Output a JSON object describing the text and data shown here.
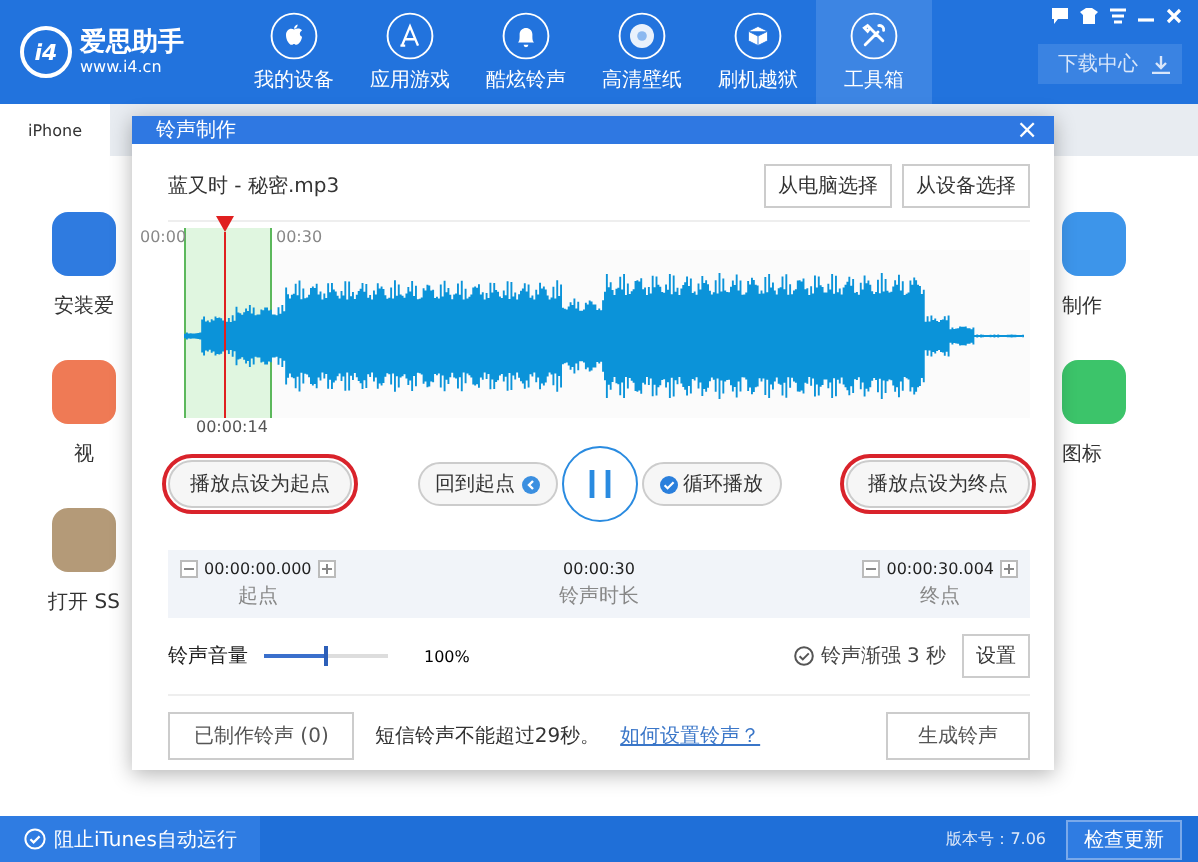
{
  "header": {
    "logo": {
      "mark": "i4",
      "name": "爱思助手",
      "url": "www.i4.cn"
    },
    "nav": [
      {
        "label": "我的设备",
        "selected": false
      },
      {
        "label": "应用游戏",
        "selected": false
      },
      {
        "label": "酷炫铃声",
        "selected": false
      },
      {
        "label": "高清壁纸",
        "selected": false
      },
      {
        "label": "刷机越狱",
        "selected": false
      },
      {
        "label": "工具箱",
        "selected": true
      }
    ],
    "download_button": "下载中心"
  },
  "tabs": [
    {
      "label": "iPhone",
      "selected": true
    }
  ],
  "background_apps_left": [
    {
      "label": "安装爱",
      "color": "#2f7be0"
    },
    {
      "label": "视",
      "color": "#ef7a55"
    },
    {
      "label": "打开 SS",
      "color": "#b49a78"
    }
  ],
  "background_apps_right": [
    {
      "label": "制作",
      "color": "#3d95ea"
    },
    {
      "label": "图标",
      "color": "#3cc46a"
    }
  ],
  "dialog": {
    "title": "铃声制作",
    "close": "×",
    "file_name": "蓝又时 - 秘密.mp3",
    "source_buttons": [
      "从电脑选择",
      "从设备选择"
    ],
    "timeline": {
      "ticks": [
        "00:00",
        "00:30"
      ],
      "playhead_time": "00:00:14"
    },
    "set_start_button": {
      "label": "播放点设为起点",
      "highlighted": true
    },
    "back_to_start": "回到起点",
    "playing": true,
    "loop": {
      "label": "循环播放",
      "checked": true
    },
    "set_end_button": {
      "label": "播放点设为终点",
      "highlighted": true
    },
    "start": {
      "value": "00:00:00.000",
      "label": "起点"
    },
    "duration": {
      "value": "00:00:30",
      "label": "铃声时长"
    },
    "end": {
      "value": "00:00:30.004",
      "label": "终点"
    },
    "volume": {
      "label": "铃声音量",
      "level": 0.5,
      "reading": "100%"
    },
    "fade_in": {
      "label": "铃声渐强 3 秒",
      "checked": true
    },
    "settings_button": "设置",
    "made_button": "已制作铃声 (0)",
    "hint": "短信铃声不能超过29秒。",
    "help_link": "如何设置铃声？",
    "generate_button": "生成铃声"
  },
  "status_bar": {
    "itunes": {
      "label": "阻止iTunes自动运行",
      "checked": true
    },
    "version": "版本号：7.06",
    "update_button": "检查更新"
  }
}
